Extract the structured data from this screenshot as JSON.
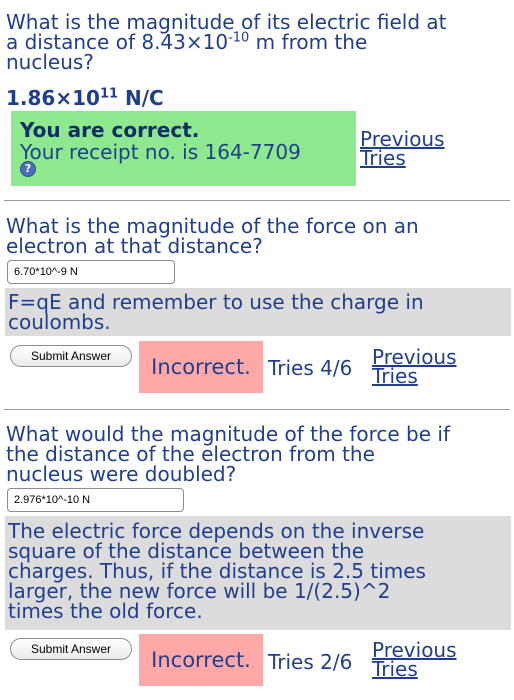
{
  "q1": {
    "question_line1": "What is the magnitude of its electric field at",
    "question_line2_pre": "a distance of 8.43×10",
    "question_line2_exp": "-10",
    "question_line2_post": " m from the",
    "question_line3": "nucleus?",
    "answer_base": "1.86×10",
    "answer_exp": "11",
    "answer_unit": " N/C",
    "correct_title": "You are correct.",
    "receipt": "Your receipt no. is 164-7709",
    "help_icon": "?",
    "prev_line1": "Previous",
    "prev_line2": "Tries"
  },
  "q2": {
    "question_line1": "What is the magnitude of the force on an",
    "question_line2": "electron at that distance?",
    "input_value": "6.70*10^-9 N",
    "hint_line1": "F=qE and remember to use the charge in",
    "hint_line2": "coulombs.",
    "submit_label": "Submit Answer",
    "status": "Incorrect.",
    "tries": "Tries 4/6",
    "prev_line1": "Previous",
    "prev_line2": "Tries"
  },
  "q3": {
    "question_line1": "What would the magnitude of the force be if",
    "question_line2": "the distance of the electron from the",
    "question_line3": "nucleus were doubled?",
    "input_value": "2.976*10^-10 N",
    "hint_line1": "The electric force depends on the inverse",
    "hint_line2": "square of the distance between the",
    "hint_line3": "charges. Thus, if the distance is 2.5 times",
    "hint_line4": "larger, the new force will be 1/(2.5)^2",
    "hint_line5": "times the old force.",
    "submit_label": "Submit Answer",
    "status": "Incorrect.",
    "tries": "Tries 2/6",
    "prev_line1": "Previous",
    "prev_line2": "Tries"
  },
  "colors": {
    "text": "#1f3e8c",
    "correct_bg": "#8ee88e",
    "incorrect_bg": "#ffa8a8",
    "hint_bg": "#dcdcdc"
  }
}
